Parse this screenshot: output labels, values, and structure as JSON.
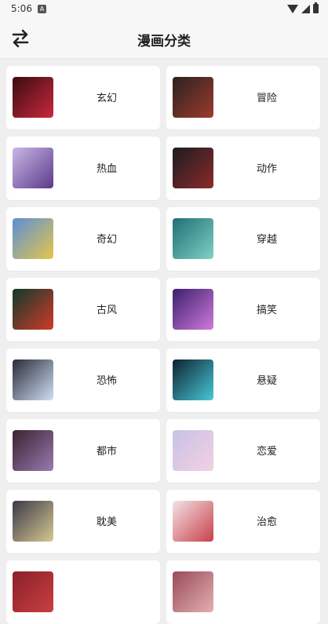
{
  "status": {
    "time": "5:06",
    "notif": "A"
  },
  "header": {
    "title": "漫画分类"
  },
  "categories": [
    {
      "label": "玄幻",
      "c1": "#3a0d12",
      "c2": "#c8283a"
    },
    {
      "label": "冒险",
      "c1": "#2b2220",
      "c2": "#9c3a2e"
    },
    {
      "label": "热血",
      "c1": "#c9b7e6",
      "c2": "#5b3a8c"
    },
    {
      "label": "动作",
      "c1": "#1c1c22",
      "c2": "#8b2a2a"
    },
    {
      "label": "奇幻",
      "c1": "#5b8fd8",
      "c2": "#e5c64a"
    },
    {
      "label": "穿越",
      "c1": "#1d6f76",
      "c2": "#7fd2c3"
    },
    {
      "label": "古风",
      "c1": "#0f3a2a",
      "c2": "#d13a2a"
    },
    {
      "label": "搞笑",
      "c1": "#3b1f6e",
      "c2": "#d07ad9"
    },
    {
      "label": "恐怖",
      "c1": "#2a2a3a",
      "c2": "#cfe0f3"
    },
    {
      "label": "悬疑",
      "c1": "#0d2230",
      "c2": "#49c7d8"
    },
    {
      "label": "都市",
      "c1": "#3a2230",
      "c2": "#9a7ab0"
    },
    {
      "label": "恋爱",
      "c1": "#c7c2e6",
      "c2": "#f3d0e3"
    },
    {
      "label": "耽美",
      "c1": "#3a3a4a",
      "c2": "#d8c890"
    },
    {
      "label": "治愈",
      "c1": "#f2e3e6",
      "c2": "#c8404a"
    },
    {
      "label": "",
      "c1": "#8a1f2a",
      "c2": "#c94040"
    },
    {
      "label": "",
      "c1": "#9a4a5a",
      "c2": "#e3b0b0"
    }
  ]
}
